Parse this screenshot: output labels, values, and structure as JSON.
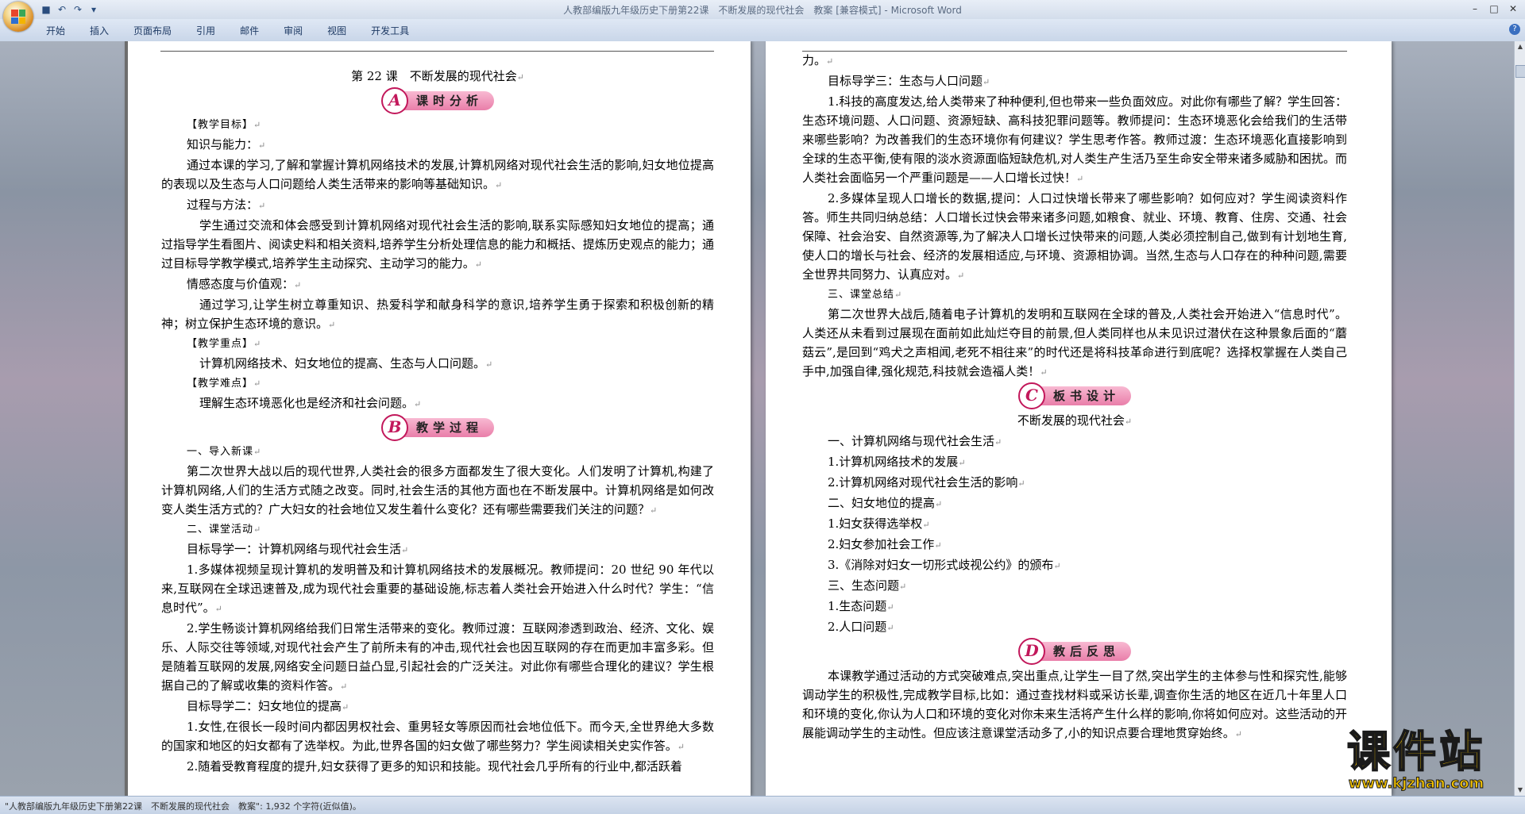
{
  "window": {
    "title": "人教部编版九年级历史下册第22课　不断发展的现代社会　教案 [兼容模式] - Microsoft Word"
  },
  "menu": {
    "tabs": [
      "开始",
      "插入",
      "页面布局",
      "引用",
      "邮件",
      "审阅",
      "视图",
      "开发工具"
    ]
  },
  "status": {
    "text": "\"人教部编版九年级历史下册第22课　不断发展的现代社会　教案\": 1,932 个字符(近似值)。"
  },
  "watermark": {
    "main": "课件站",
    "sub": "www.kjzhan.com"
  },
  "left_page": {
    "title": "第 22 课　不断发展的现代社会",
    "banner_a": {
      "letter": "A",
      "label": "课时分析"
    },
    "jxmb_head": "【教学目标】",
    "zsnl_head": "知识与能力：",
    "zsnl_text": "通过本课的学习,了解和掌握计算机网络技术的发展,计算机网络对现代社会生活的影响,妇女地位提高的表现以及生态与人口问题给人类生活带来的影响等基础知识。",
    "gcff_head": "过程与方法：",
    "gcff_text": "学生通过交流和体会感受到计算机网络对现代社会生活的影响,联系实际感知妇女地位的提高；通过指导学生看图片、阅读史料和相关资料,培养学生分析处理信息的能力和概括、提炼历史观点的能力；通过目标导学教学模式,培养学生主动探究、主动学习的能力。",
    "qgtd_head": "情感态度与价值观：",
    "qgtd_text": "通过学习,让学生树立尊重知识、热爱科学和献身科学的意识,培养学生勇于探索和积极创新的精神；树立保护生态环境的意识。",
    "jxzd_head": "【教学重点】",
    "jxzd_text": "计算机网络技术、妇女地位的提高、生态与人口问题。",
    "jxnd_head": "【教学难点】",
    "jxnd_text": "理解生态环境恶化也是经济和社会问题。",
    "banner_b": {
      "letter": "B",
      "label": "教学过程"
    },
    "drxk_head": "一、导入新课",
    "drxk_text": "第二次世界大战以后的现代世界,人类社会的很多方面都发生了很大变化。人们发明了计算机,构建了计算机网络,人们的生活方式随之改变。同时,社会生活的其他方面也在不断发展中。计算机网络是如何改变人类生活方式的？广大妇女的社会地位又发生着什么变化？还有哪些需要我们关注的问题？",
    "kthd_head": "二、课堂活动",
    "mb1_head": "目标导学一：计算机网络与现代社会生活",
    "mb1_p1": "1.多媒体视频呈现计算机的发明普及和计算机网络技术的发展概况。教师提问：20 世纪 90 年代以来,互联网在全球迅速普及,成为现代社会重要的基础设施,标志着人类社会开始进入什么时代？学生：“信息时代”。",
    "mb1_p2": "2.学生畅谈计算机网络给我们日常生活带来的变化。教师过渡：互联网渗透到政治、经济、文化、娱乐、人际交往等领域,对现代社会产生了前所未有的冲击,现代社会也因互联网的存在而更加丰富多彩。但是随着互联网的发展,网络安全问题日益凸显,引起社会的广泛关注。对此你有哪些合理化的建议？学生根据自己的了解或收集的资料作答。",
    "mb2_head": "目标导学二：妇女地位的提高",
    "mb2_p1": "1.女性,在很长一段时间内都因男权社会、重男轻女等原因而社会地位低下。而今天,全世界绝大多数的国家和地区的妇女都有了选举权。为此,世界各国的妇女做了哪些努力？学生阅读相关史实作答。",
    "mb2_p2": "2.随着受教育程度的提升,妇女获得了更多的知识和技能。现代社会几乎所有的行业中,都活跃着"
  },
  "right_page": {
    "cont": "力。",
    "mb3_head": "目标导学三：生态与人口问题",
    "mb3_p1": "1.科技的高度发达,给人类带来了种种便利,但也带来一些负面效应。对此你有哪些了解？学生回答：生态环境问题、人口问题、资源短缺、高科技犯罪问题等。教师提问：生态环境恶化会给我们的生活带来哪些影响？为改善我们的生态环境你有何建议？学生思考作答。教师过渡：生态环境恶化直接影响到全球的生态平衡,使有限的淡水资源面临短缺危机,对人类生产生活乃至生命安全带来诸多威胁和困扰。而人类社会面临另一个严重问题是——人口增长过快！",
    "mb3_p2": "2.多媒体呈现人口增长的数据,提问：人口过快增长带来了哪些影响？如何应对？学生阅读资料作答。师生共同归纳总结：人口增长过快会带来诸多问题,如粮食、就业、环境、教育、住房、交通、社会保障、社会治安、自然资源等,为了解决人口增长过快带来的问题,人类必须控制自己,做到有计划地生育,使人口的增长与社会、经济的发展相适应,与环境、资源相协调。当然,生态与人口存在的种种问题,需要全世界共同努力、认真应对。",
    "ktzj_head": "三、课堂总结",
    "ktzj_text": "第二次世界大战后,随着电子计算机的发明和互联网在全球的普及,人类社会开始进入“信息时代”。人类还从未看到过展现在面前如此灿烂夺目的前景,但人类同样也从未见识过潜伏在这种景象后面的“蘑菇云”,是回到“鸡犬之声相闻,老死不相往来”的时代还是将科技革命进行到底呢？选择权掌握在人类自己手中,加强自律,强化规范,科技就会造福人类！",
    "banner_c": {
      "letter": "C",
      "label": "板书设计"
    },
    "bs_title": "不断发展的现代社会",
    "bs_lines": [
      "一、计算机网络与现代社会生活",
      "1.计算机网络技术的发展",
      "2.计算机网络对现代社会生活的影响",
      "二、妇女地位的提高",
      "1.妇女获得选举权",
      "2.妇女参加社会工作",
      "3.《消除对妇女一切形式歧视公约》的颁布",
      "三、生态问题",
      "1.生态问题",
      "2.人口问题"
    ],
    "banner_d": {
      "letter": "D",
      "label": "教后反思"
    },
    "fs_text": "本课教学通过活动的方式突破难点,突出重点,让学生一目了然,突出学生的主体参与性和探究性,能够调动学生的积极性,完成教学目标,比如：通过查找材料或采访长辈,调查你生活的地区在近几十年里人口和环境的变化,你认为人口和环境的变化对你未来生活将产生什么样的影响,你将如何应对。这些活动的开展能调动学生的主动性。但应该注意课堂活动多了,小的知识点要合理地贯穿始终。"
  },
  "colors": {
    "banner_accent": "#c2185b",
    "banner_fill": "#f8b9d2",
    "watermark": "#f3c200"
  }
}
